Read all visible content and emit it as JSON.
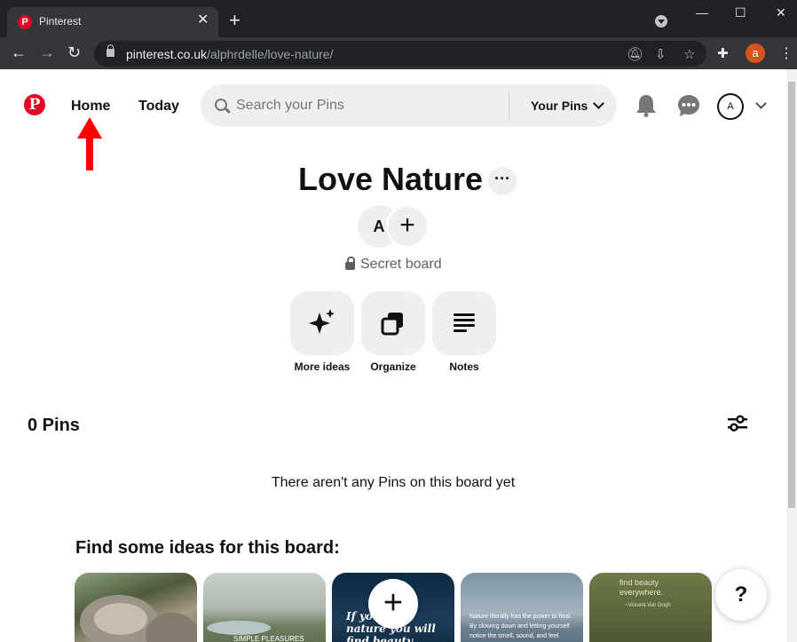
{
  "browser": {
    "tab_title": "Pinterest",
    "tab_close": "✕",
    "new_tab": "+",
    "url_domain": "pinterest.co.uk",
    "url_path": "/alphrdelle/love-nature/",
    "profile_initial": "a",
    "window_controls": {
      "minimize": "—",
      "maximize": "☐",
      "close": "✕"
    }
  },
  "header": {
    "logo_letter": "P",
    "nav": {
      "home": "Home",
      "today": "Today"
    },
    "search": {
      "placeholder": "Search your Pins",
      "scope_label": "Your Pins"
    },
    "avatar_initial": "A",
    "annotation_color": "#ff0000"
  },
  "board": {
    "title": "Love Nature",
    "more_label": "···",
    "collaborator_initial": "A",
    "add_collaborator": "+",
    "visibility": "Secret board",
    "actions": [
      {
        "label": "More ideas",
        "icon": "sparkle-icon"
      },
      {
        "label": "Organize",
        "icon": "organize-icon"
      },
      {
        "label": "Notes",
        "icon": "notes-icon"
      }
    ],
    "pin_count": "0 Pins",
    "empty_message": "There aren't any Pins on this board yet"
  },
  "ideas": {
    "title": "Find some ideas for this board:",
    "thumbnails": [
      {
        "text": ""
      },
      {
        "text": "SIMPLE PLEASURES"
      },
      {
        "text": "If you love nature you will find beauty"
      },
      {
        "text": "Nature literally has the power to heal. By slowing down and letting yourself notice the smell, sound, and feel"
      },
      {
        "text": "find beauty everywhere.",
        "author": "~Vincent Van Gogh"
      }
    ],
    "add_label": "+"
  },
  "help_label": "?",
  "colors": {
    "brand": "#e60023",
    "chrome_dark": "#202124",
    "chrome_toolbar": "#35363a",
    "surface": "#efefef"
  }
}
